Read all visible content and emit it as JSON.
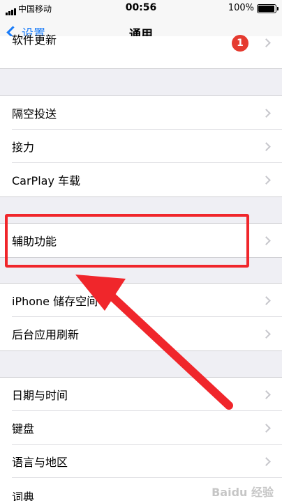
{
  "status_bar": {
    "carrier": "中国移动",
    "time": "00:56",
    "battery": "100%",
    "battery_level": 1.0
  },
  "nav": {
    "back_label": "设置",
    "title": "通用"
  },
  "rows": {
    "software_update": {
      "label": "软件更新",
      "badge": "1"
    },
    "airdrop": {
      "label": "隔空投送"
    },
    "handoff": {
      "label": "接力"
    },
    "carplay": {
      "label": "CarPlay 车载"
    },
    "accessibility": {
      "label": "辅助功能"
    },
    "storage": {
      "label": "iPhone 储存空间"
    },
    "background_refresh": {
      "label": "后台应用刷新"
    },
    "date_time": {
      "label": "日期与时间"
    },
    "keyboard": {
      "label": "键盘"
    },
    "language_region": {
      "label": "语言与地区"
    },
    "dictionary": {
      "label": "词典"
    }
  },
  "watermark": "Baidu 经验",
  "colors": {
    "accent": "#1a7cf8",
    "badge": "#e53b30",
    "annotation": "#f0262b"
  }
}
